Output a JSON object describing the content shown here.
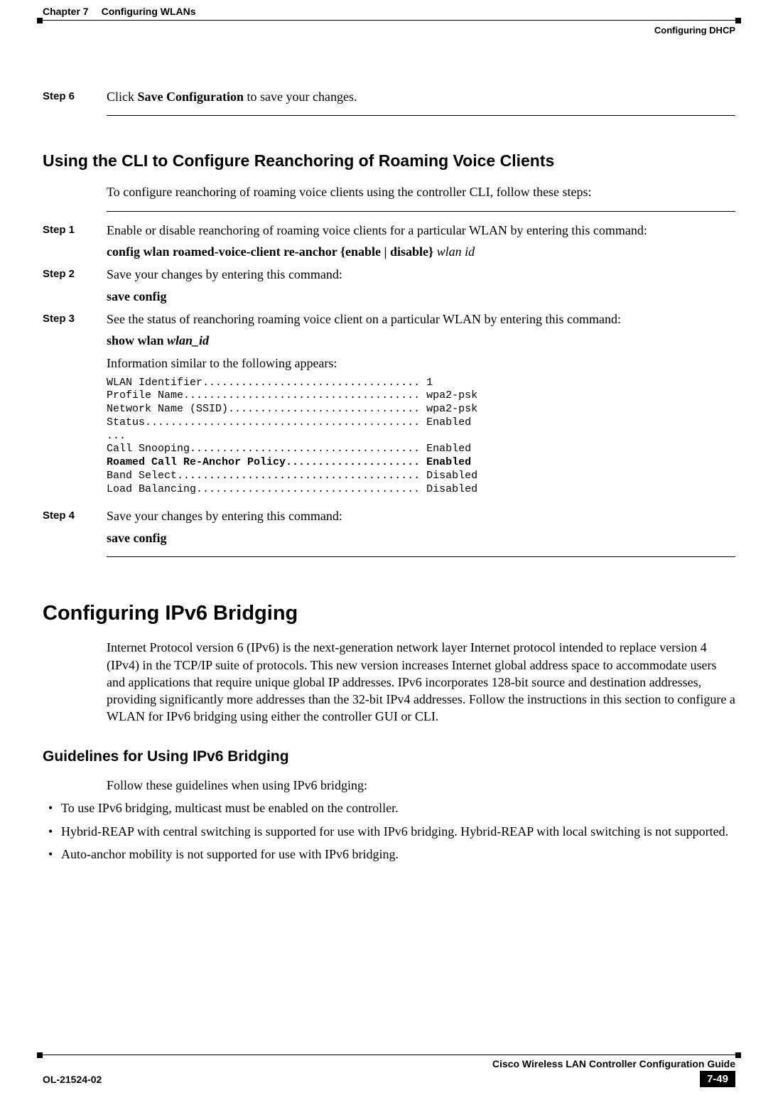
{
  "header": {
    "chapter_label": "Chapter 7",
    "chapter_title": "Configuring WLANs",
    "section_right": "Configuring DHCP"
  },
  "step6": {
    "label": "Step 6",
    "pre": "Click ",
    "bold": "Save Configuration",
    "post": " to save your changes."
  },
  "cli_section": {
    "title": "Using the CLI to Configure Reanchoring of Roaming Voice Clients",
    "intro": "To configure reanchoring of roaming voice clients using the controller CLI, follow these steps:",
    "step1": {
      "label": "Step 1",
      "text": "Enable or disable reanchoring of roaming voice clients for a particular WLAN by entering this command:",
      "cmd_bold": "config wlan roamed-voice-client re-anchor {enable | disable} ",
      "cmd_italic": "wlan id"
    },
    "step2": {
      "label": "Step 2",
      "text": "Save your changes by entering this command:",
      "cmd_bold": "save config"
    },
    "step3": {
      "label": "Step 3",
      "text": "See the status of reanchoring roaming voice client on a particular WLAN by entering this command:",
      "cmd_bold": "show wlan ",
      "cmd_italic": "wlan_id",
      "info_leadin": "Information similar to the following appears:",
      "output_line1": "WLAN Identifier.................................. 1",
      "output_line2": "Profile Name..................................... wpa2-psk",
      "output_line3": "Network Name (SSID).............................. wpa2-psk",
      "output_line4": "Status........................................... Enabled",
      "output_line5": "...",
      "output_line6": "Call Snooping.................................... Enabled",
      "output_line7_bold": "Roamed Call Re-Anchor Policy..................... Enabled",
      "output_line8": "Band Select...................................... Disabled",
      "output_line9": "Load Balancing................................... Disabled"
    },
    "step4": {
      "label": "Step 4",
      "text": "Save your changes by entering this command:",
      "cmd_bold": "save config"
    }
  },
  "ipv6": {
    "title": "Configuring IPv6 Bridging",
    "para": "Internet Protocol version 6 (IPv6) is the next-generation network layer Internet protocol intended to replace version 4 (IPv4) in the TCP/IP suite of protocols. This new version increases Internet global address space to accommodate users and applications that require unique global IP addresses. IPv6 incorporates 128-bit source and destination addresses, providing significantly more addresses than the 32-bit IPv4 addresses. Follow the instructions in this section to configure a WLAN for IPv6 bridging using either the controller GUI or CLI.",
    "guidelines_title": "Guidelines for Using IPv6 Bridging",
    "guidelines_intro": "Follow these guidelines when using IPv6 bridging:",
    "bullets": {
      "b1": "To use IPv6 bridging, multicast must be enabled on the controller.",
      "b2": "Hybrid-REAP with central switching is supported for use with IPv6 bridging. Hybrid-REAP with local switching is not supported.",
      "b3": "Auto-anchor mobility is not supported for use with IPv6 bridging."
    }
  },
  "footer": {
    "guide_title": "Cisco Wireless LAN Controller Configuration Guide",
    "doc_id": "OL-21524-02",
    "page_num": "7-49"
  }
}
